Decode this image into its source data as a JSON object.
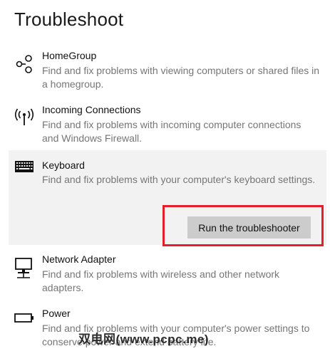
{
  "page": {
    "title": "Troubleshoot"
  },
  "items": [
    {
      "name": "HomeGroup",
      "description": "Find and fix problems with viewing computers or shared files in a homegroup.",
      "icon": "homegroup-icon"
    },
    {
      "name": "Incoming Connections",
      "description": "Find and fix problems with incoming computer connections and Windows Firewall.",
      "icon": "antenna-icon"
    },
    {
      "name": "Keyboard",
      "description": "Find and fix problems with your computer's keyboard settings.",
      "icon": "keyboard-icon",
      "selected": true,
      "action_label": "Run the troubleshooter"
    },
    {
      "name": "Network Adapter",
      "description": "Find and fix problems with wireless and other network adapters.",
      "icon": "network-adapter-icon"
    },
    {
      "name": "Power",
      "description": "Find and fix problems with your computer's power settings to conserve power and extend battery life.",
      "icon": "battery-icon"
    }
  ],
  "watermark": {
    "text": "双电网(www.pcpc.me)"
  },
  "colors": {
    "highlight": "#e0202a",
    "selected_bg": "#f2f2f2",
    "button_bg": "#cccccc",
    "description": "#767676"
  }
}
